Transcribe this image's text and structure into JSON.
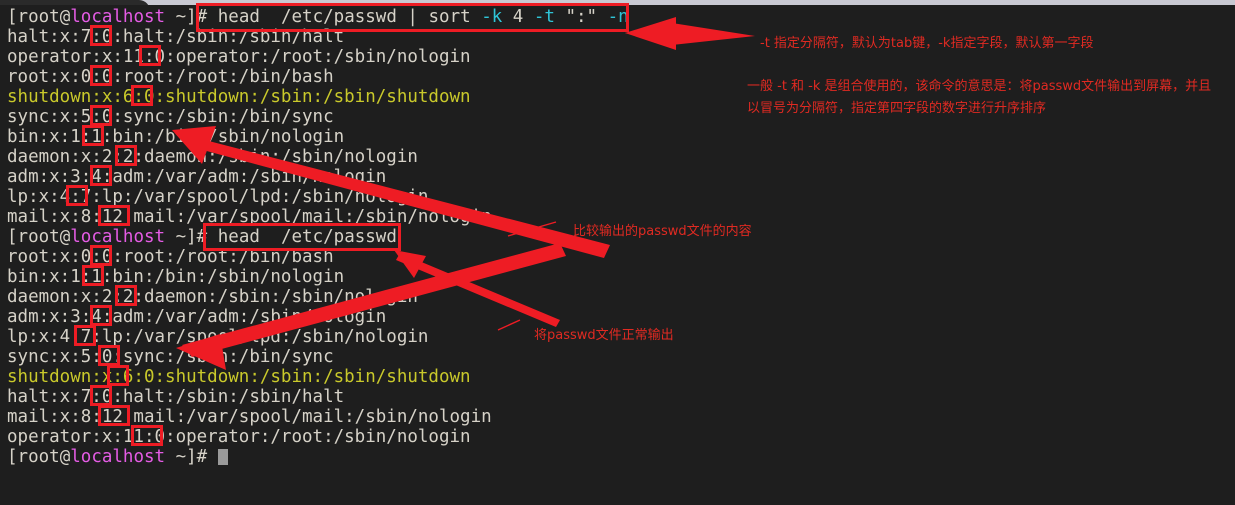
{
  "terminal": {
    "prompt_user": "root",
    "prompt_at": "@",
    "prompt_host": "localhost",
    "prompt_tail": " ~]# ",
    "prompt_open": "[",
    "lines": [
      {
        "id": "l1",
        "type": "prompt",
        "command": "head  /etc/passwd | sort -k 4 -t \":\" -n"
      },
      {
        "id": "l2",
        "type": "output",
        "text": "halt:x:7:0:halt:/sbin:/sbin/halt"
      },
      {
        "id": "l3",
        "type": "output",
        "text": "operator:x:11:0:operator:/root:/sbin/nologin"
      },
      {
        "id": "l4",
        "type": "output",
        "text": "root:x:0:0:root:/root:/bin/bash"
      },
      {
        "id": "l5",
        "type": "output",
        "text": "shutdown:x:6:0:shutdown:/sbin:/sbin/shutdown"
      },
      {
        "id": "l6",
        "type": "output",
        "text": "sync:x:5:0:sync:/sbin:/bin/sync"
      },
      {
        "id": "l7",
        "type": "output",
        "text": "bin:x:1:1:bin:/bin:/sbin/nologin"
      },
      {
        "id": "l8",
        "type": "output",
        "text": "daemon:x:2:2:daemon:/sbin:/sbin/nologin"
      },
      {
        "id": "l9",
        "type": "output",
        "text": "adm:x:3:4:adm:/var/adm:/sbin/nologin"
      },
      {
        "id": "l10",
        "type": "output",
        "text": "lp:x:4:7:lp:/var/spool/lpd:/sbin/nologin"
      },
      {
        "id": "l11",
        "type": "output",
        "text": "mail:x:8:12:mail:/var/spool/mail:/sbin/nologin"
      },
      {
        "id": "l12",
        "type": "prompt",
        "command": "head  /etc/passwd"
      },
      {
        "id": "l13",
        "type": "output",
        "text": "root:x:0:0:root:/root:/bin/bash"
      },
      {
        "id": "l14",
        "type": "output",
        "text": "bin:x:1:1:bin:/bin:/sbin/nologin"
      },
      {
        "id": "l15",
        "type": "output",
        "text": "daemon:x:2:2:daemon:/sbin:/sbin/nologin"
      },
      {
        "id": "l16",
        "type": "output",
        "text": "adm:x:3:4:adm:/var/adm:/sbin/nologin"
      },
      {
        "id": "l17",
        "type": "output",
        "text": "lp:x:4:7:lp:/var/spool/lpd:/sbin/nologin"
      },
      {
        "id": "l18",
        "type": "output",
        "text": "sync:x:5:0:sync:/sbin:/bin/sync"
      },
      {
        "id": "l19",
        "type": "output",
        "text": "shutdown:x:6:0:shutdown:/sbin:/sbin/shutdown"
      },
      {
        "id": "l20",
        "type": "output",
        "text": "halt:x:7:0:halt:/sbin:/sbin/halt"
      },
      {
        "id": "l21",
        "type": "output",
        "text": "mail:x:8:12:mail:/var/spool/mail:/sbin/nologin"
      },
      {
        "id": "l22",
        "type": "output",
        "text": "operator:x:11:0:operator:/root:/sbin/nologin"
      },
      {
        "id": "l23",
        "type": "prompt",
        "command": ""
      }
    ],
    "cmd1_head": "head  ",
    "cmd1_path": "/etc/passwd ",
    "cmd1_pipe": "| ",
    "cmd1_sort": "sort ",
    "cmd1_k": "-k",
    "cmd1_knum": " 4 ",
    "cmd1_t": "-t",
    "cmd1_sep": " \":\" ",
    "cmd1_n": "-n",
    "cmd2_head": "head  ",
    "cmd2_path": "/etc/passwd"
  },
  "annotations": {
    "a1": "-t 指定分隔符，默认为tab键，-k指定字段，默认第一字段",
    "a2_line1": "一般 -t 和 -k 是组合使用的，该命令的意思是：将passwd文件输出到屏幕，并且",
    "a2_line2": "以冒号为分隔符，指定第四字段的数字进行升序排序",
    "a3": "比较输出的passwd文件的内容",
    "a4": "将passwd文件正常输出"
  },
  "colors": {
    "annotation_red": "#e02a22",
    "box_red": "#ee1c24",
    "terminal_bg": "#1e1e1e",
    "text_fg": "#d6d2c8",
    "host_magenta": "#e55ce5",
    "shutdown_yellow": "#c9c92b",
    "flag_cyan": "#2fc4d6"
  },
  "highlight_boxes": [
    {
      "name": "gid-halt-7",
      "value": "0"
    },
    {
      "name": "gid-operator-11",
      "value": "0"
    },
    {
      "name": "gid-root-0",
      "value": "0"
    },
    {
      "name": "gid-shutdown-6",
      "value": "0"
    },
    {
      "name": "gid-sync-5",
      "value": "0"
    },
    {
      "name": "gid-bin-1",
      "value": "1"
    },
    {
      "name": "gid-daemon-2",
      "value": "2"
    },
    {
      "name": "gid-adm-3",
      "value": "4"
    },
    {
      "name": "gid-lp-4",
      "value": "7"
    },
    {
      "name": "gid-mail-8",
      "value": "12"
    },
    {
      "name": "gid2-root-0",
      "value": "0"
    },
    {
      "name": "gid2-bin-1",
      "value": "1"
    },
    {
      "name": "gid2-daemon-2",
      "value": "2"
    },
    {
      "name": "gid2-adm-3",
      "value": "4"
    },
    {
      "name": "gid2-lp-4",
      "value": "7"
    },
    {
      "name": "gid2-sync-5",
      "value": "0"
    },
    {
      "name": "gid2-shutdown-6",
      "value": "6"
    },
    {
      "name": "gid2-halt-7",
      "value": "0"
    },
    {
      "name": "gid2-mail-8",
      "value": "12"
    },
    {
      "name": "gid2-operator-11",
      "value": "11"
    }
  ]
}
